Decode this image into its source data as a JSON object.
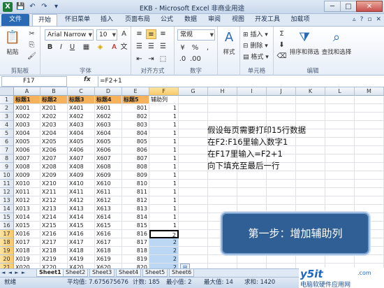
{
  "window": {
    "app_icon": "X",
    "title": "EKB - Microsoft Excel 非商业用途",
    "controls": [
      "─",
      "□",
      "✕"
    ]
  },
  "ribbon_tabs": {
    "file": "文件",
    "items": [
      "开始",
      "怀旧菜单",
      "插入",
      "页面布局",
      "公式",
      "数据",
      "审阅",
      "视图",
      "开发工具",
      "加载项"
    ],
    "active": "开始"
  },
  "ribbon": {
    "clipboard": {
      "paste": "粘贴",
      "label": "剪贴板"
    },
    "font": {
      "name": "Arial Narrow",
      "size": "10",
      "label": "字体"
    },
    "alignment": {
      "label": "对齐方式"
    },
    "number": {
      "format": "常规",
      "label": "数字"
    },
    "styles": {
      "button": "样式"
    },
    "cells": {
      "insert": "插入",
      "delete": "删除",
      "format": "格式",
      "label": "单元格"
    },
    "editing": {
      "sort_filter": "排序和筛选",
      "find_select": "查找和选择",
      "label": "编辑"
    }
  },
  "formula_bar": {
    "name_box": "F17",
    "fx": "fx",
    "formula": "=F2+1"
  },
  "grid": {
    "columns": [
      "A",
      "B",
      "C",
      "D",
      "E",
      "F",
      "G",
      "H",
      "I",
      "J",
      "K",
      "L",
      "M"
    ],
    "header_row": [
      "标题1",
      "标题2",
      "标题3",
      "标题4",
      "标题5",
      "辅助列"
    ],
    "rows": [
      [
        "X001",
        "X201",
        "X401",
        "X601",
        "801",
        "1"
      ],
      [
        "X002",
        "X202",
        "X402",
        "X602",
        "802",
        "1"
      ],
      [
        "X003",
        "X203",
        "X403",
        "X603",
        "803",
        "1"
      ],
      [
        "X004",
        "X204",
        "X404",
        "X604",
        "804",
        "1"
      ],
      [
        "X005",
        "X205",
        "X405",
        "X605",
        "805",
        "1"
      ],
      [
        "X006",
        "X206",
        "X406",
        "X606",
        "806",
        "1"
      ],
      [
        "X007",
        "X207",
        "X407",
        "X607",
        "807",
        "1"
      ],
      [
        "X008",
        "X208",
        "X408",
        "X608",
        "808",
        "1"
      ],
      [
        "X009",
        "X209",
        "X409",
        "X609",
        "809",
        "1"
      ],
      [
        "X010",
        "X210",
        "X410",
        "X610",
        "810",
        "1"
      ],
      [
        "X011",
        "X211",
        "X411",
        "X611",
        "811",
        "1"
      ],
      [
        "X012",
        "X212",
        "X412",
        "X612",
        "812",
        "1"
      ],
      [
        "X013",
        "X213",
        "X413",
        "X613",
        "813",
        "1"
      ],
      [
        "X014",
        "X214",
        "X414",
        "X614",
        "814",
        "1"
      ],
      [
        "X015",
        "X215",
        "X415",
        "X615",
        "815",
        "1"
      ],
      [
        "X016",
        "X216",
        "X416",
        "X616",
        "816",
        "2"
      ],
      [
        "X017",
        "X217",
        "X417",
        "X617",
        "817",
        "2"
      ],
      [
        "X018",
        "X218",
        "X418",
        "X618",
        "818",
        "2"
      ],
      [
        "X019",
        "X219",
        "X419",
        "X619",
        "819",
        "2"
      ],
      [
        "X020",
        "X220",
        "X420",
        "X620",
        "820",
        "2"
      ]
    ]
  },
  "note_lines": [
    "假设每页需要打印15行数据",
    "在F2:F16里输入数字1",
    "在F17里输入=F2+1",
    "向下填充至最后一行"
  ],
  "callout": "第一步：增加辅助列",
  "sheet_tabs": [
    "Sheet1",
    "Sheet2",
    "Sheet3",
    "Sheet4",
    "Sheet5",
    "Sheet6"
  ],
  "status": {
    "mode": "就绪",
    "average": "平均值: 7.675675676",
    "count": "计数: 185",
    "min": "最小值: 2",
    "max": "最大值: 14",
    "sum": "求和: 1420"
  },
  "watermark": {
    "logo": "y5it",
    "com": ".com",
    "sub": "电脑软硬件应用网"
  },
  "colors": {
    "header_fill": "#f6b25a",
    "selection": "#bcd7f4",
    "callout_bg": "#2f5f95",
    "file_tab": "#2a6ab5"
  }
}
